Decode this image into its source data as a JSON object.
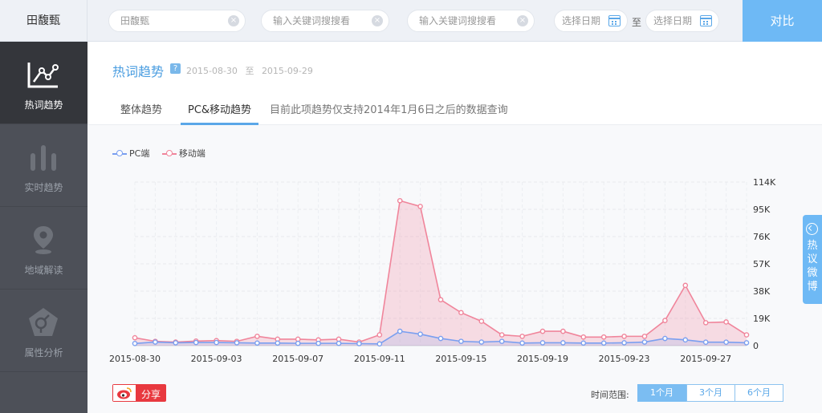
{
  "topbar": {
    "brand": "田馥甄",
    "keyword1": "田馥甄",
    "keyword2_placeholder": "输入关键词搜搜看",
    "keyword3_placeholder": "输入关键词搜搜看",
    "start_date_placeholder": "选择日期",
    "to": "至",
    "end_date_placeholder": "选择日期",
    "compare": "对比"
  },
  "sidebar": {
    "items": [
      {
        "label": "热词趋势",
        "icon": "trend-line-icon",
        "active": true
      },
      {
        "label": "实时趋势",
        "icon": "bar-chart-icon",
        "active": false
      },
      {
        "label": "地域解读",
        "icon": "map-pin-icon",
        "active": false
      },
      {
        "label": "属性分析",
        "icon": "gender-icon",
        "active": false
      }
    ]
  },
  "header": {
    "title": "热词趋势",
    "help": "?",
    "start": "2015-08-30",
    "to": "至",
    "end": "2015-09-29"
  },
  "tabs": {
    "overall": "整体趋势",
    "pc_mobile": "PC&移动趋势",
    "note": "目前此项趋势仅支持2014年1月6日之后的数据查询"
  },
  "colors": {
    "pc": "#7a9ff0",
    "mobile": "#f0859b",
    "accent": "#6eb9f5"
  },
  "chart_data": {
    "type": "area",
    "x_ticks": [
      "2015-08-30",
      "2015-09-03",
      "2015-09-07",
      "2015-09-11",
      "2015-09-15",
      "2015-09-19",
      "2015-09-23",
      "2015-09-27"
    ],
    "y_ticks": [
      "0",
      "19K",
      "38K",
      "57K",
      "76K",
      "95K",
      "114K"
    ],
    "ylim": [
      0,
      114000
    ],
    "x": [
      "2015-08-30",
      "2015-08-31",
      "2015-09-01",
      "2015-09-02",
      "2015-09-03",
      "2015-09-04",
      "2015-09-05",
      "2015-09-06",
      "2015-09-07",
      "2015-09-08",
      "2015-09-09",
      "2015-09-10",
      "2015-09-11",
      "2015-09-12",
      "2015-09-13",
      "2015-09-14",
      "2015-09-15",
      "2015-09-16",
      "2015-09-17",
      "2015-09-18",
      "2015-09-19",
      "2015-09-20",
      "2015-09-21",
      "2015-09-22",
      "2015-09-23",
      "2015-09-24",
      "2015-09-25",
      "2015-09-26",
      "2015-09-27",
      "2015-09-28",
      "2015-09-29"
    ],
    "series": [
      {
        "name": "PC端",
        "values": [
          1500,
          2500,
          2000,
          2200,
          2200,
          2000,
          1800,
          1800,
          1600,
          1600,
          1600,
          1400,
          1200,
          10000,
          8000,
          5000,
          3000,
          2500,
          3000,
          1800,
          2000,
          2000,
          1800,
          1800,
          2000,
          2500,
          5000,
          4000,
          2400,
          2400,
          2000
        ]
      },
      {
        "name": "移动端",
        "values": [
          5500,
          3000,
          2500,
          3200,
          3500,
          3000,
          6500,
          4500,
          4500,
          4000,
          4500,
          2500,
          7500,
          101000,
          97000,
          32000,
          23000,
          17000,
          7500,
          6500,
          10000,
          10000,
          6000,
          6000,
          6500,
          6500,
          17500,
          42000,
          16000,
          16500,
          7500
        ]
      }
    ]
  },
  "footer": {
    "share": "分享",
    "range_label": "时间范围:",
    "ranges": [
      "1个月",
      "3个月",
      "6个月"
    ]
  },
  "float_tab": {
    "label": "热议微博"
  }
}
